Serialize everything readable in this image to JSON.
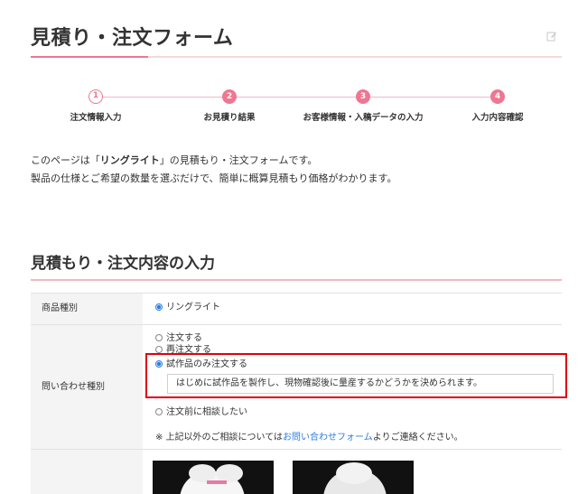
{
  "page": {
    "title": "見積り・注文フォーム"
  },
  "steps": [
    {
      "number": "1",
      "label": "注文情報入力",
      "state": "active"
    },
    {
      "number": "2",
      "label": "お見積り結果",
      "state": "todo"
    },
    {
      "number": "3",
      "label": "お客様情報・入稿データの入力",
      "state": "todo"
    },
    {
      "number": "4",
      "label": "入力内容確認",
      "state": "todo"
    }
  ],
  "intro": {
    "line1_prefix": "このページは「",
    "line1_product": "リングライト",
    "line1_suffix": "」の見積もり・注文フォームです。",
    "line2": "製品の仕様とご希望の数量を選ぶだけで、簡単に概算見積もり価格がわかります。"
  },
  "section": {
    "title": "見積もり・注文内容の入力"
  },
  "form": {
    "product_type": {
      "label": "商品種別",
      "option": "リングライト",
      "checked": true
    },
    "inquiry_type": {
      "label": "問い合わせ種別",
      "options": [
        {
          "label": "注文する",
          "checked": false
        },
        {
          "label": "再注文する",
          "checked": false
        },
        {
          "label": "試作品のみ注文する",
          "checked": true
        },
        {
          "label": "注文前に相談したい",
          "checked": false
        }
      ],
      "note": "はじめに試作品を製作し、現物確認後に量産するかどうかを決められます。",
      "footnote_prefix": "※ 上記以外のご相談については",
      "footnote_link": "お問い合わせフォーム",
      "footnote_suffix": "よりご連絡ください。"
    }
  },
  "colors": {
    "accent": "#ee7791",
    "highlight": "#e0000c",
    "link": "#2a7de1"
  },
  "icons": {
    "edit": "edit-icon"
  }
}
